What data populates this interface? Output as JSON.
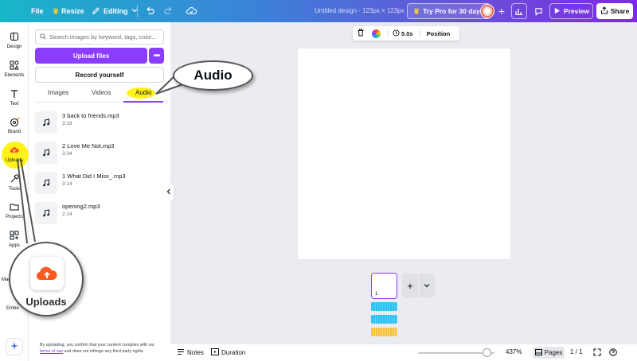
{
  "topbar": {
    "file_label": "File",
    "resize_label": "Resize",
    "editing_label": "Editing",
    "design_title": "Untitled design - 123px × 123px",
    "try_pro_label": "Try Pro for 30 days",
    "preview_label": "Preview",
    "share_label": "Share"
  },
  "rail": {
    "items": [
      {
        "label": "Design",
        "icon": "design-icon"
      },
      {
        "label": "Elements",
        "icon": "elements-icon"
      },
      {
        "label": "Text",
        "icon": "text-icon"
      },
      {
        "label": "Brand",
        "icon": "brand-icon"
      },
      {
        "label": "Uploads",
        "icon": "uploads-icon"
      },
      {
        "label": "Tools",
        "icon": "tools-icon"
      },
      {
        "label": "Projects",
        "icon": "projects-icon"
      },
      {
        "label": "Apps",
        "icon": "apps-icon"
      },
      {
        "label": "Mag",
        "icon": "magic-icon"
      },
      {
        "label": "Embe",
        "icon": "embed-icon"
      }
    ]
  },
  "panel": {
    "search_placeholder": "Search images by keyword, tags, color...",
    "upload_files_label": "Upload files",
    "record_yourself_label": "Record yourself",
    "tabs": [
      {
        "label": "Images"
      },
      {
        "label": "Videos"
      },
      {
        "label": "Audio"
      }
    ],
    "active_tab": "Audio",
    "audio_items": [
      {
        "name": "3 back to friends.mp3",
        "duration": "3:19"
      },
      {
        "name": "2 Love Me Not.mp3",
        "duration": "3:34"
      },
      {
        "name": "1 What Did I Miss_.mp3",
        "duration": "3:14"
      },
      {
        "name": "opening2.mp3",
        "duration": "2:14"
      }
    ],
    "terms_pre": "By uploading, you confirm that your content complies with our",
    "terms_link": "terms of use",
    "terms_post": "and does not infringe any third party rights."
  },
  "context_toolbar": {
    "duration_label": "5.0s",
    "position_label": "Position"
  },
  "pages": {
    "current_page_number": "1"
  },
  "bottombar": {
    "notes_label": "Notes",
    "duration_label": "Duration",
    "zoom_label": "437%",
    "zoom_level_fraction": 0.9,
    "pages_label": "Pages",
    "page_count_label": "1 / 1"
  },
  "callouts": {
    "audio_label": "Audio",
    "uploads_label": "Uploads"
  },
  "colors": {
    "accent": "#8b3dff",
    "highlight": "#fff21a",
    "uploads_orange": "#ff5a1f",
    "audio_track": "#27c0f5",
    "audio_track_alt": "#f5c242"
  }
}
